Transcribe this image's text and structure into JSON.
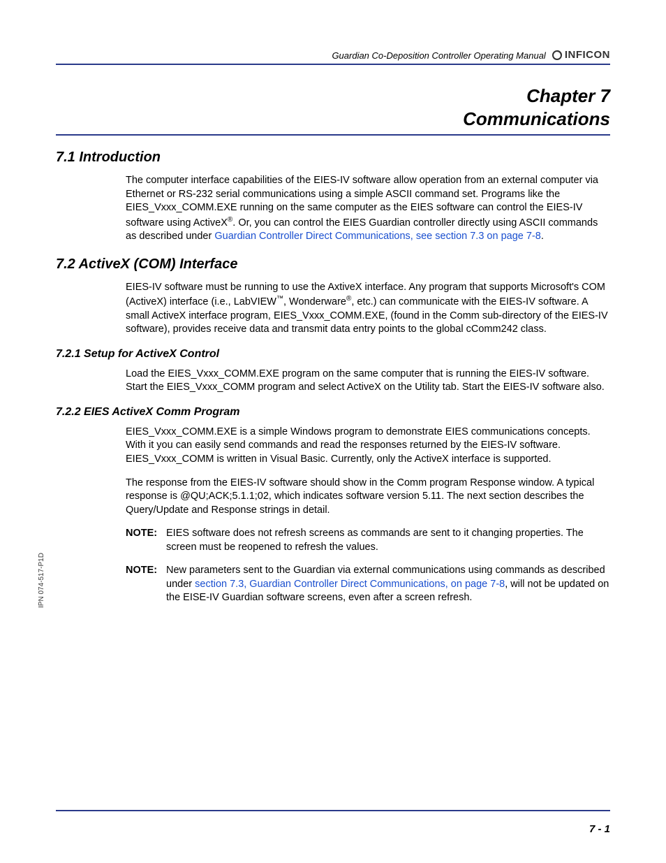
{
  "header": {
    "manual_title": "Guardian Co-Deposition Controller Operating Manual",
    "logo_text": "INFICON"
  },
  "chapter": {
    "line1": "Chapter 7",
    "line2": "Communications"
  },
  "sections": {
    "s71": {
      "heading": "7.1  Introduction",
      "p1a": "The computer interface capabilities of the EIES-IV software allow operation from an external computer via Ethernet or RS-232 serial communications using a simple ASCII command set. Programs like the EIES_Vxxx_COMM.EXE running on the same computer as the EIES software can control the EIES-IV software using ActiveX",
      "p1b": ". Or, you can control the EIES Guardian controller directly using ASCII commands as described under ",
      "p1link": "Guardian Controller Direct Communications, see section 7.3 on page 7-8",
      "p1c": "."
    },
    "s72": {
      "heading": "7.2  ActiveX (COM) Interface",
      "p1a": "EIES-IV software must be running to use the AxtiveX interface. Any program that supports Microsoft's COM (ActiveX) interface (i.e., LabVIEW",
      "p1b": ", Wonderware",
      "p1c": ", etc.) can communicate with the EIES-IV software. A small ActiveX interface program, EIES_Vxxx_COMM.EXE, (found in the Comm sub-directory of the EIES-IV software), provides receive data and transmit data entry points to the global cComm242 class."
    },
    "s721": {
      "heading": "7.2.1  Setup for ActiveX Control",
      "p1": "Load the EIES_Vxxx_COMM.EXE program on the same computer that is running the EIES-IV software. Start the EIES_Vxxx_COMM program and select ActiveX on the Utility tab. Start the EIES-IV software also."
    },
    "s722": {
      "heading": "7.2.2  EIES ActiveX Comm Program",
      "p1": "EIES_Vxxx_COMM.EXE is a simple Windows program to demonstrate EIES communications concepts. With it you can easily send commands and read the responses returned by the EIES-IV software. EIES_Vxxx_COMM is written in Visual Basic. Currently, only the ActiveX interface is supported.",
      "p2": "The response from the EIES-IV software should show in the Comm program Response window. A typical response is @QU;ACK;5.1.1;02, which indicates software version 5.11. The next section describes the Query/Update and Response strings in detail.",
      "note_label": "NOTE:",
      "note1": "EIES software does not refresh screens as commands are sent to it changing properties. The screen must be reopened to refresh the values.",
      "note2a": "New parameters sent to the Guardian via external communications using commands as described under ",
      "note2link": "section 7.3, Guardian Controller Direct Communications, on page 7-8",
      "note2b": ", will not be updated on the EISE-IV Guardian software screens, even after a screen refresh."
    }
  },
  "side_label": "IPN 074-517-P1D",
  "page_number": "7 - 1",
  "sup": {
    "reg": "®",
    "tm": "™"
  }
}
